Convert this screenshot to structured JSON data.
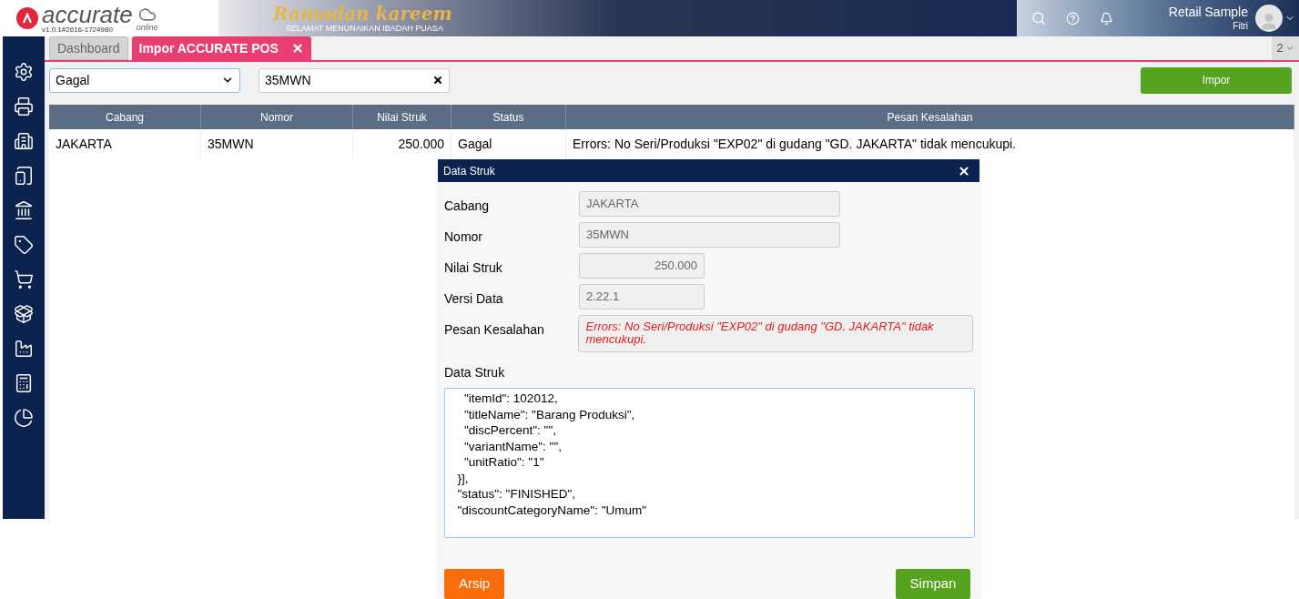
{
  "header": {
    "logo_text": "accurate",
    "logo_sub": "online",
    "version": "v1.0.1#2616-1724980",
    "banner_title": "Ramadan kareem",
    "banner_subtitle": "SELAMAT MENUNAIKAN IBADAH PUASA",
    "company": "Retail Sample",
    "user": "Fitri"
  },
  "tabs": [
    {
      "label": "Dashboard",
      "selected": false,
      "closable": false
    },
    {
      "label": "Impor ACCURATE POS",
      "selected": true,
      "closable": true
    }
  ],
  "tab_count": "2",
  "filter": {
    "status_value": "Gagal",
    "search_value": "35MWN"
  },
  "import_button": "Impor",
  "table": {
    "columns": [
      "Cabang",
      "Nomor",
      "Nilai Struk",
      "Status",
      "Pesan Kesalahan"
    ],
    "rows": [
      [
        "JAKARTA",
        "35MWN",
        "250.000",
        "Gagal",
        "Errors: No Seri/Produksi \"EXP02\" di gudang \"GD. JAKARTA\" tidak mencukupi."
      ]
    ]
  },
  "dialog": {
    "title": "Data Struk",
    "fields": [
      {
        "label": "Cabang",
        "value": "JAKARTA",
        "kind": "wide"
      },
      {
        "label": "Nomor",
        "value": "35MWN",
        "kind": "wide"
      },
      {
        "label": "Nilai Struk",
        "value": "250.000",
        "kind": "number"
      },
      {
        "label": "Versi Data",
        "value": "2.22.1",
        "kind": "short"
      },
      {
        "label": "Pesan Kesalahan",
        "value": "Errors: No Seri/Produksi \"EXP02\" di gudang \"GD. JAKARTA\" tidak mencukupi.",
        "kind": "error"
      }
    ],
    "data_label": "Data Struk",
    "data_lines": [
      "    \"itemId\": 102012,",
      "    \"titleName\": \"Barang Produksi\",",
      "    \"discPercent\": \"\",",
      "    \"variantName\": \"\",",
      "    \"unitRatio\": \"1\"",
      "  }],",
      "  \"status\": \"FINISHED\",",
      "  \"discountCategoryName\": \"Umum\""
    ],
    "archive_button": "Arsip",
    "save_button": "Simpan"
  }
}
